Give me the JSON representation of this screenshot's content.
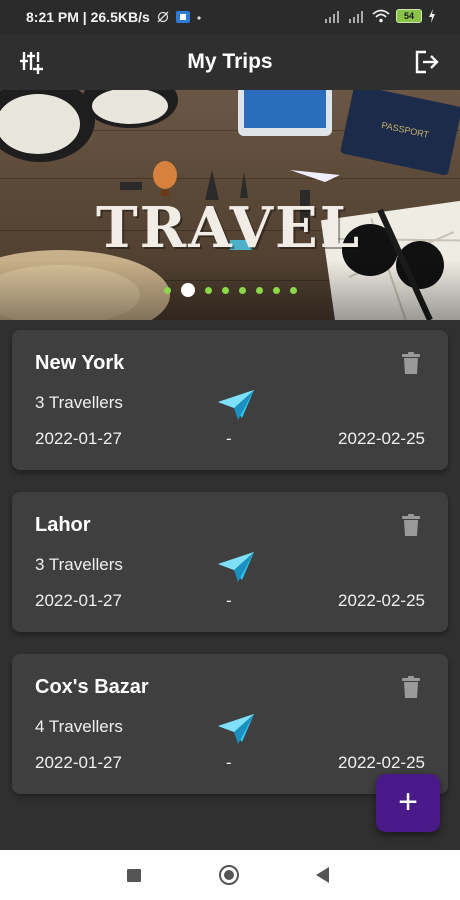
{
  "status_bar": {
    "time": "8:21 PM | 26.5KB/s",
    "battery": "54"
  },
  "app_bar": {
    "title": "My Trips",
    "left_icon": "sliders-icon",
    "right_icon": "logout-icon"
  },
  "banner": {
    "word": "TRAVEL",
    "pages": 8,
    "active_page": 2
  },
  "trips": [
    {
      "name": "New York",
      "travellers": "3 Travellers",
      "start": "2022-01-27",
      "separator": "-",
      "end": "2022-02-25"
    },
    {
      "name": "Lahor",
      "travellers": "3 Travellers",
      "start": "2022-01-27",
      "separator": "-",
      "end": "2022-02-25"
    },
    {
      "name": "Cox's Bazar",
      "travellers": "4 Travellers",
      "start": "2022-01-27",
      "separator": "-",
      "end": "2022-02-25"
    }
  ],
  "fab": {
    "label": "+"
  },
  "colors": {
    "background": "#303030",
    "card": "#3f3f3f",
    "accent": "#4a1a8a",
    "dot": "#8bd94a",
    "plane": "#29c6ef"
  }
}
